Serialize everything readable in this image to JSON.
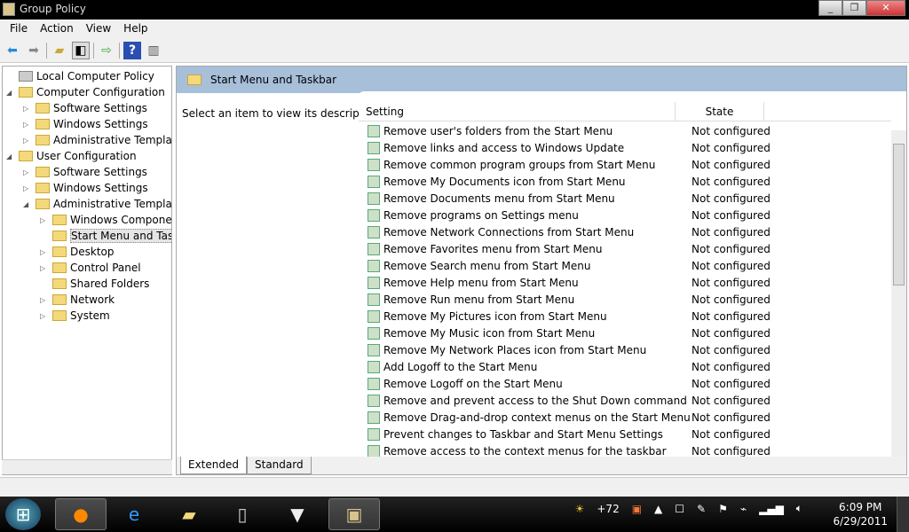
{
  "window": {
    "title": "Group Policy",
    "buttons": [
      "_",
      "❐",
      "✕"
    ]
  },
  "menu": [
    "File",
    "Action",
    "View",
    "Help"
  ],
  "toolbar": [
    "back-icon",
    "forward-icon",
    "up-folder-icon",
    "show-hide-tree-icon",
    "export-list-icon",
    "help-icon",
    "show-action-pane-icon"
  ],
  "tree": [
    {
      "label": "Local Computer Policy",
      "level": 0,
      "exp": ""
    },
    {
      "label": "Computer Configuration",
      "level": 0,
      "exp": "◢"
    },
    {
      "label": "Software Settings",
      "level": 1,
      "exp": "▷"
    },
    {
      "label": "Windows Settings",
      "level": 1,
      "exp": "▷"
    },
    {
      "label": "Administrative Templates",
      "level": 1,
      "exp": "▷"
    },
    {
      "label": "User Configuration",
      "level": 0,
      "exp": "◢"
    },
    {
      "label": "Software Settings",
      "level": 1,
      "exp": "▷"
    },
    {
      "label": "Windows Settings",
      "level": 1,
      "exp": "▷"
    },
    {
      "label": "Administrative Templates",
      "level": 1,
      "exp": "◢"
    },
    {
      "label": "Windows Components",
      "level": 2,
      "exp": "▷"
    },
    {
      "label": "Start Menu and Taskbar",
      "level": 2,
      "exp": "",
      "selected": true
    },
    {
      "label": "Desktop",
      "level": 2,
      "exp": "▷"
    },
    {
      "label": "Control Panel",
      "level": 2,
      "exp": "▷"
    },
    {
      "label": "Shared Folders",
      "level": 2,
      "exp": ""
    },
    {
      "label": "Network",
      "level": 2,
      "exp": "▷"
    },
    {
      "label": "System",
      "level": 2,
      "exp": "▷"
    }
  ],
  "pane": {
    "title": "Start Menu and Taskbar",
    "description": "Select an item to view its description.",
    "col_setting": "Setting",
    "col_state": "State"
  },
  "settings": [
    [
      "Remove user's folders from the Start Menu",
      "Not configured"
    ],
    [
      "Remove links and access to Windows Update",
      "Not configured"
    ],
    [
      "Remove common program groups from Start Menu",
      "Not configured"
    ],
    [
      "Remove My Documents icon from Start Menu",
      "Not configured"
    ],
    [
      "Remove Documents menu from Start Menu",
      "Not configured"
    ],
    [
      "Remove programs on Settings menu",
      "Not configured"
    ],
    [
      "Remove Network Connections from Start Menu",
      "Not configured"
    ],
    [
      "Remove Favorites menu from Start Menu",
      "Not configured"
    ],
    [
      "Remove Search menu from Start Menu",
      "Not configured"
    ],
    [
      "Remove Help menu from Start Menu",
      "Not configured"
    ],
    [
      "Remove Run menu from Start Menu",
      "Not configured"
    ],
    [
      "Remove My Pictures icon from Start Menu",
      "Not configured"
    ],
    [
      "Remove My Music icon from Start Menu",
      "Not configured"
    ],
    [
      "Remove My Network Places icon from Start Menu",
      "Not configured"
    ],
    [
      "Add Logoff to the Start Menu",
      "Not configured"
    ],
    [
      "Remove Logoff on the Start Menu",
      "Not configured"
    ],
    [
      "Remove and prevent access to the Shut Down command",
      "Not configured"
    ],
    [
      "Remove Drag-and-drop context menus on the Start Menu",
      "Not configured"
    ],
    [
      "Prevent changes to Taskbar and Start Menu Settings",
      "Not configured"
    ],
    [
      "Remove access to the context menus for the taskbar",
      "Not configured"
    ]
  ],
  "tabs": [
    "Extended",
    "Standard"
  ],
  "taskbar": {
    "weather": "+72",
    "time": "6:09 PM",
    "date": "6/29/2011"
  }
}
